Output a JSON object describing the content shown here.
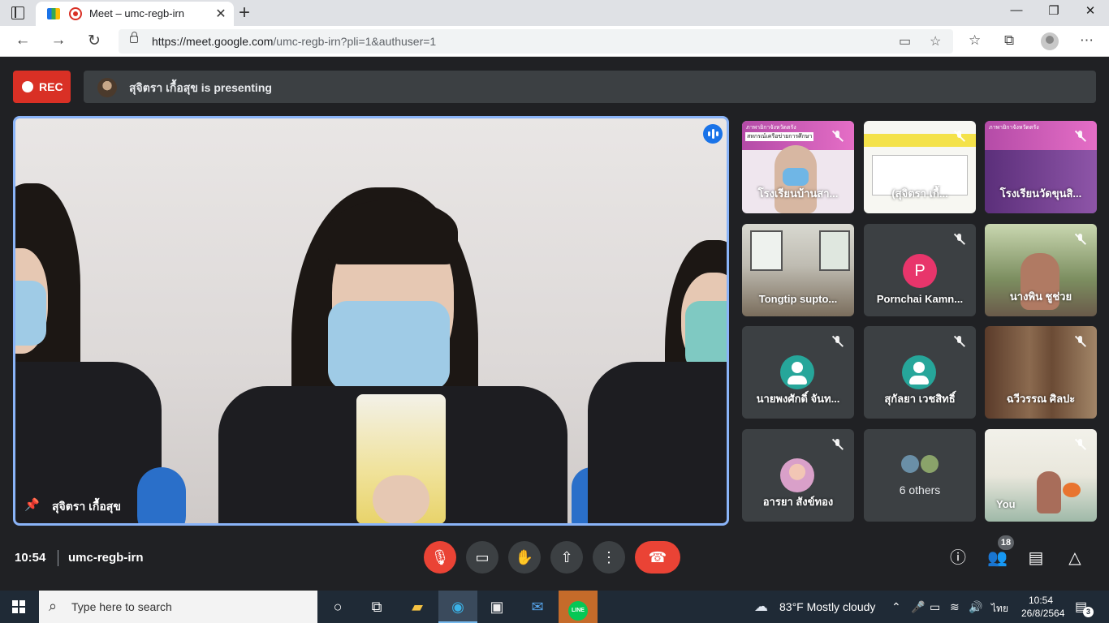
{
  "browser": {
    "tab_title": "Meet – umc-regb-irn",
    "url_host": "https://meet.google.com",
    "url_path": "/umc-regb-irn?pli=1&authuser=1"
  },
  "meet": {
    "rec_label": "REC",
    "presenting_text": "สุจิตรา เกื้อสุข is presenting",
    "main_speaker_name": "สุจิตรา เกื้อสุข",
    "tiles": [
      {
        "name": "โรงเรียนบ้านสา..."
      },
      {
        "name": "(สุจิตรา เกื้..."
      },
      {
        "name": "โรงเรียนวัดขุนสิ..."
      },
      {
        "name": "Tongtip supto..."
      },
      {
        "name": "Pornchai Kamn...",
        "initial": "P",
        "color": "#e8356b"
      },
      {
        "name": "นางพิน ชูช่วย"
      },
      {
        "name": "นายพงศักดิ์ จันท..."
      },
      {
        "name": "สุกัลยา เวชสิทธิ์"
      },
      {
        "name": "ฉวีวรรณ ศิลปะ"
      },
      {
        "name": "อารยา สังข์ทอง"
      },
      {
        "others_label": "6 others"
      },
      {
        "name": "You"
      }
    ],
    "slide_header": "ภาพายิกาจังหวัดตรัง",
    "slide_sub": "สหกรณ์เครือข่ายการศึกษา",
    "clock": "10:54",
    "meeting_code": "umc-regb-irn",
    "participants_count": "18"
  },
  "taskbar": {
    "search_placeholder": "Type here to search",
    "weather": "83°F  Mostly cloudy",
    "lang": "ไทย",
    "time": "10:54",
    "date": "26/8/2564",
    "notif_count": "3"
  },
  "icons": {
    "accent": "#8ab4f8",
    "red": "#ea4335"
  }
}
